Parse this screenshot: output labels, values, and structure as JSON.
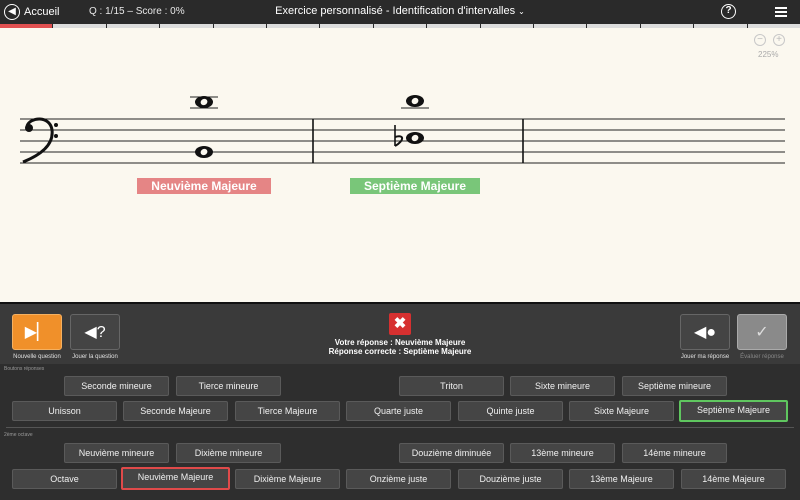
{
  "header": {
    "home_label": "Accueil",
    "score": "Q : 1/15 – Score : 0%",
    "title": "Exercice personnalisé - Identification d'intervalles",
    "title_chevron": "⌄",
    "help_glyph": "?"
  },
  "progress": {
    "total": 15,
    "current_index": 0,
    "current_status": "wrong"
  },
  "zoom": {
    "out_glyph": "−",
    "in_glyph": "+",
    "level": "225%"
  },
  "score_area": {
    "clef": "bass",
    "measures": [
      {
        "lower_note": "C3",
        "upper_note": "D4",
        "accidental": "",
        "label": "Neuvième Majeure",
        "status": "wrong"
      },
      {
        "lower_note": "Bb3",
        "upper_note": "A4",
        "accidental": "♭",
        "label": "Septième Majeure",
        "status": "correct"
      }
    ]
  },
  "controls": {
    "next_question_label": "Nouvelle question",
    "play_question_label": "Jouer la question",
    "play_answer_label": "Jouer ma réponse",
    "evaluate_label": "Évaluer réponse",
    "result_mark": "✖",
    "your_answer": "Votre réponse : Neuvième Majeure",
    "correct_answer": "Réponse correcte : Septième Majeure",
    "colors": {
      "accent": "#f0902a",
      "wrong": "#d63030",
      "correct": "#5fc65f"
    }
  },
  "answers": {
    "section1_label": "Boutons réponses",
    "section2_label": "2ème octave",
    "row1": [
      "Seconde mineure",
      "Tierce mineure",
      "Triton",
      "Sixte mineure",
      "Septième mineure"
    ],
    "row2": [
      "Unisson",
      "Seconde Majeure",
      "Tierce Majeure",
      "Quarte juste",
      "Quinte juste",
      "Sixte Majeure",
      "Septième Majeure"
    ],
    "row3": [
      "Neuvième mineure",
      "Dixième mineure",
      "Douzième diminuée",
      "13ème mineure",
      "14ème mineure"
    ],
    "row4": [
      "Octave",
      "Neuvième Majeure",
      "Dixième Majeure",
      "Onzième juste",
      "Douzième juste",
      "13ème Majeure",
      "14ème Majeure"
    ],
    "selected": "Neuvième Majeure",
    "correct": "Septième Majeure"
  }
}
